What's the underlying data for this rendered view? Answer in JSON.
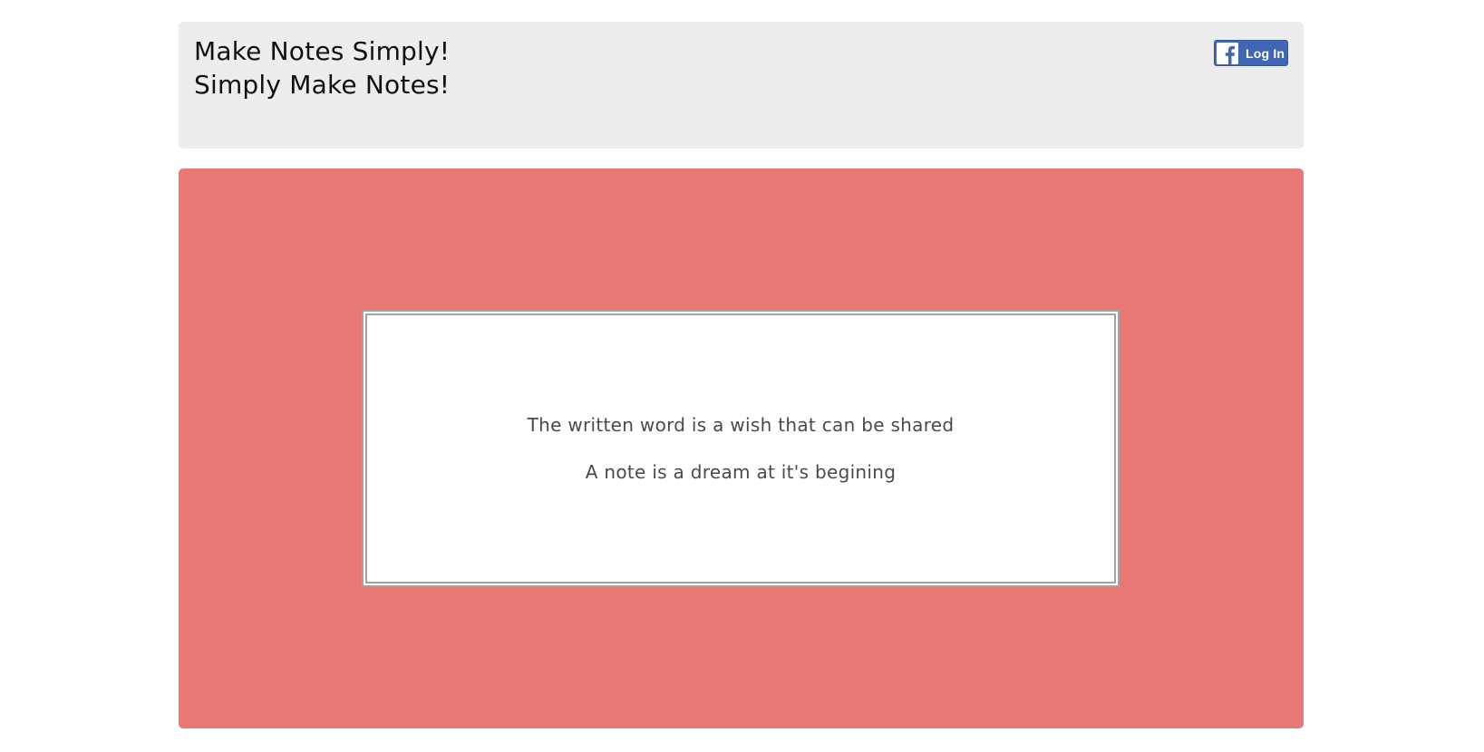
{
  "header": {
    "tagline_line1": "Make Notes Simply!",
    "tagline_line2": "Simply Make Notes!",
    "login_button": {
      "label": "Log In",
      "icon": "facebook-icon",
      "color": "#4267b2"
    },
    "background": "#ededed"
  },
  "hero": {
    "background": "#e87874",
    "quote_line1": "The written word is a wish that can be shared",
    "quote_line2": "A note is a dream at it's begining"
  }
}
